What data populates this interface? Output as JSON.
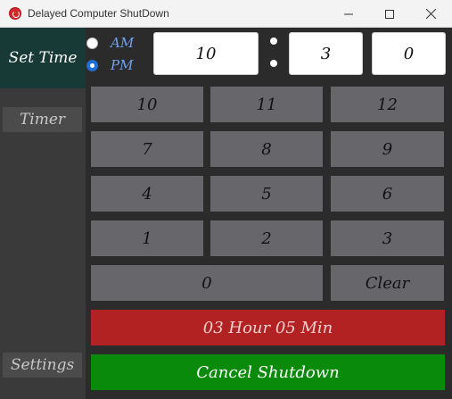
{
  "window": {
    "title": "Delayed Computer ShutDown"
  },
  "sidebar": {
    "set_time": "Set Time",
    "timer": "Timer",
    "settings": "Settings"
  },
  "ampm": {
    "am_label": "AM",
    "pm_label": "PM",
    "selected": "PM"
  },
  "time": {
    "hour": "10",
    "minute": "3",
    "second": "0"
  },
  "keypad": {
    "keys": [
      "10",
      "11",
      "12",
      "7",
      "8",
      "9",
      "4",
      "5",
      "6",
      "1",
      "2",
      "3",
      "0",
      "Clear"
    ]
  },
  "status": {
    "remaining": "03 Hour 05 Min"
  },
  "actions": {
    "cancel": "Cancel Shutdown"
  },
  "colors": {
    "sidebar_active": "#173a36",
    "status": "#b22222",
    "cancel": "#0a8a0a",
    "radio_selected": "#1f6fd6"
  }
}
